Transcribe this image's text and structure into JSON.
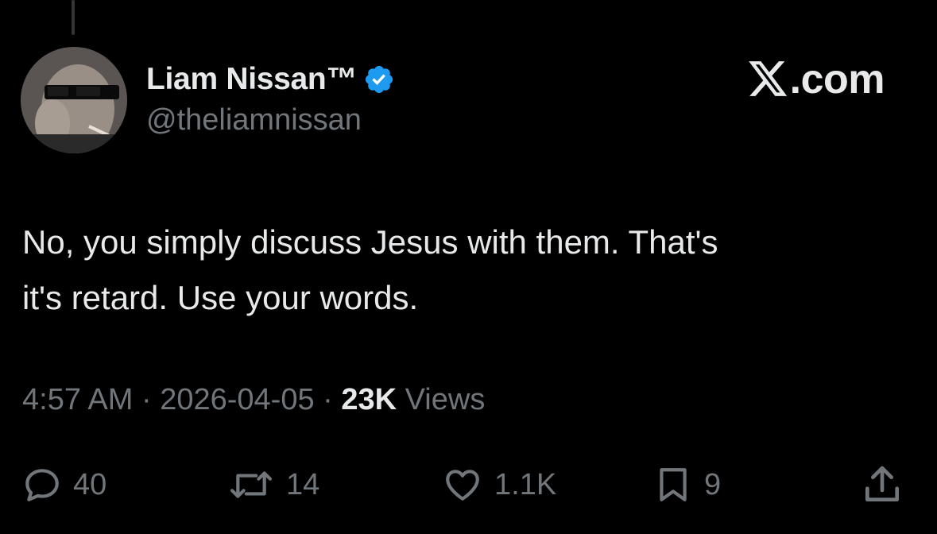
{
  "tweet": {
    "author": {
      "display_name": "Liam Nissan™",
      "handle": "@theliamnissan",
      "verified": true,
      "avatar_icon": "avatar-photo"
    },
    "site_logo": {
      "glyph": "x-logo-icon",
      "text": ".com"
    },
    "text_lines": [
      "No, you simply discuss Jesus with them. That's",
      "it's retard. Use your words."
    ],
    "meta": {
      "time": "4:57 AM",
      "separator": " · ",
      "date": "2026-04-05",
      "views_count": "23K",
      "views_label": " Views"
    },
    "actions": {
      "replies": "40",
      "reposts": "14",
      "likes": "1.1K",
      "bookmarks": "9"
    }
  },
  "colors": {
    "background": "#000000",
    "primary_text": "#e7e9ea",
    "secondary_text": "#71767b",
    "verified_blue": "#1d9bf0"
  }
}
